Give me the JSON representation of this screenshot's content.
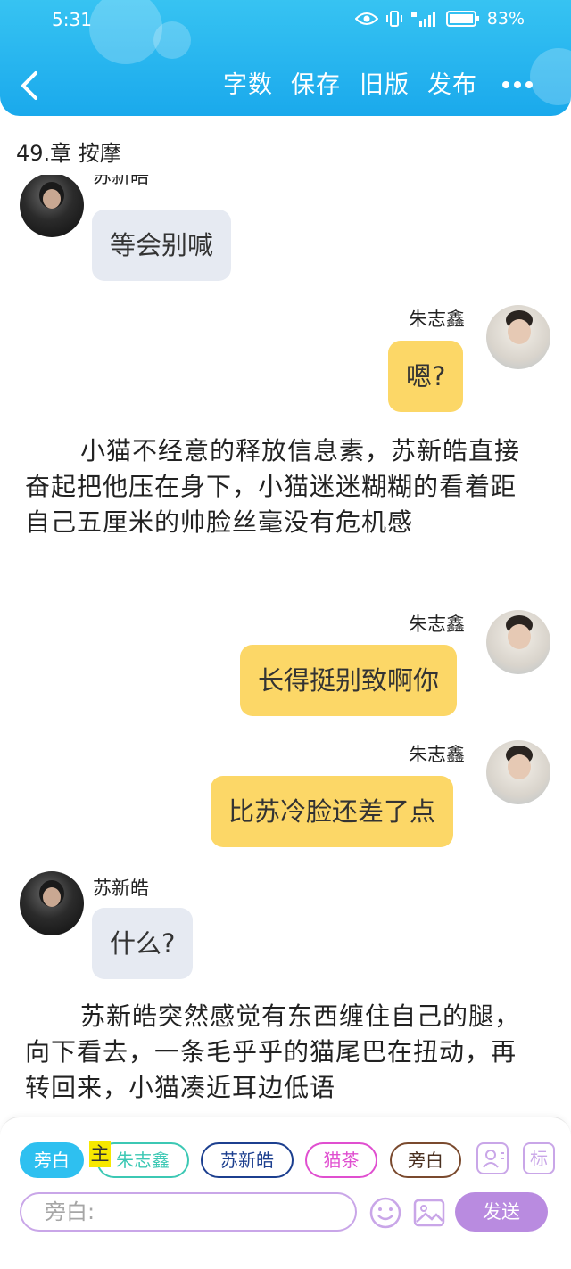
{
  "status_bar": {
    "time": "5:31",
    "battery": "83%"
  },
  "toolbar": {
    "word_count": "字数",
    "save": "保存",
    "old_version": "旧版",
    "publish": "发布"
  },
  "chapter_title": "49.章 按摩",
  "messages": [
    {
      "side": "left",
      "speaker": "苏新皓",
      "text": "等会别喊"
    },
    {
      "side": "right",
      "speaker": "朱志鑫",
      "text": "嗯?"
    },
    {
      "side": "narration",
      "text": "小猫不经意的释放信息素，苏新皓直接奋起把他压在身下，小猫迷迷糊糊的看着距自己五厘米的帅脸丝毫没有危机感"
    },
    {
      "side": "right",
      "speaker": "朱志鑫",
      "text": "长得挺别致啊你"
    },
    {
      "side": "right",
      "speaker": "朱志鑫",
      "text": "比苏冷脸还差了点"
    },
    {
      "side": "left",
      "speaker": "苏新皓",
      "text": "什么?"
    },
    {
      "side": "narration",
      "text": "苏新皓突然感觉有东西缠住自己的腿，向下看去，一条毛乎乎的猫尾巴在扭动，再转回来，小猫凑近耳边低语"
    }
  ],
  "role_chips": [
    {
      "label": "旁白",
      "color": "#2ec0f0",
      "selected": true
    },
    {
      "label": "朱志鑫",
      "color": "#3cc8b4",
      "main": true,
      "main_label": "主"
    },
    {
      "label": "苏新皓",
      "color": "#1c3f8f"
    },
    {
      "label": "猫茶",
      "color": "#e04fd0"
    },
    {
      "label": "旁白",
      "color": "#7a4a2e"
    }
  ],
  "composer": {
    "placeholder": "旁白:",
    "send": "发送",
    "tag_icon": "标"
  },
  "icons": [
    "back-icon",
    "more-icon",
    "contact-icon",
    "tag-icon",
    "emoji-icon",
    "image-icon"
  ]
}
